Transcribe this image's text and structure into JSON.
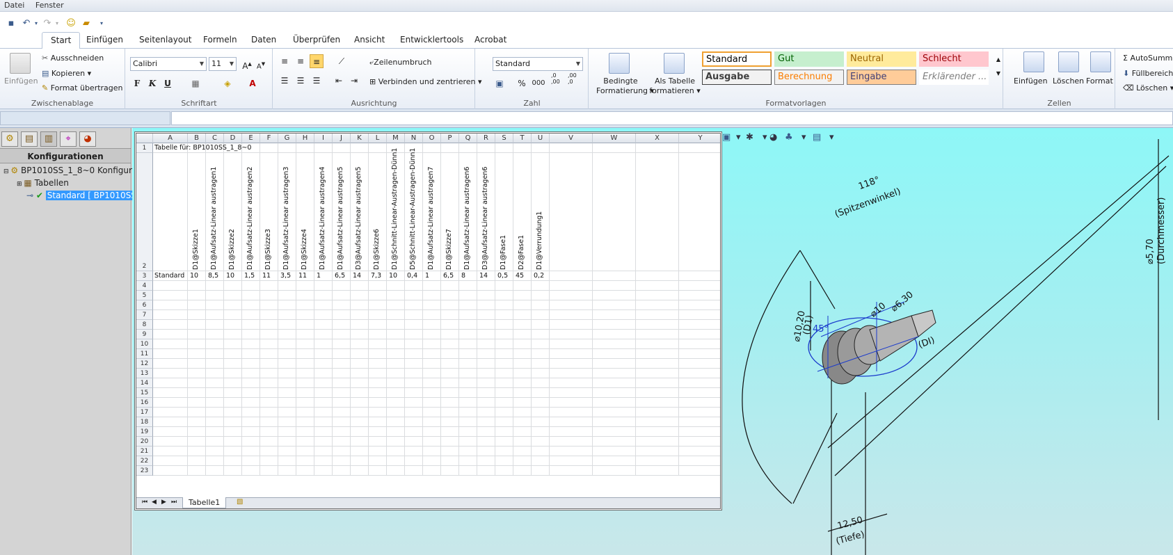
{
  "menubar": {
    "items": [
      "Datei",
      "Fenster"
    ]
  },
  "ribbon_tabs": [
    "Start",
    "Einfügen",
    "Seitenlayout",
    "Formeln",
    "Daten",
    "Überprüfen",
    "Ansicht",
    "Entwicklertools",
    "Acrobat"
  ],
  "clipboard": {
    "paste": "Einfügen",
    "cut": "Ausschneiden",
    "copy": "Kopieren",
    "format_painter": "Format übertragen",
    "group": "Zwischenablage"
  },
  "font": {
    "name": "Calibri",
    "size": "11",
    "bold": "F",
    "italic": "K",
    "underline": "U",
    "group": "Schriftart"
  },
  "alignment": {
    "wrap": "Zeilenumbruch",
    "merge": "Verbinden und zentrieren",
    "group": "Ausrichtung"
  },
  "number": {
    "format": "Standard",
    "percent": "%",
    "thousands": "000",
    "inc_decimals": ",0 ,00",
    "dec_decimals": ",00 ,0",
    "group": "Zahl"
  },
  "styles": {
    "cond_format": [
      "Bedingte",
      "Formatierung"
    ],
    "as_table": [
      "Als Tabelle",
      "formatieren"
    ],
    "cells": [
      {
        "label": "Standard",
        "bg": "#ffffff",
        "fg": "#000000",
        "border": "#f0a030"
      },
      {
        "label": "Gut",
        "bg": "#c6efce",
        "fg": "#006100",
        "border": "#c6efce"
      },
      {
        "label": "Neutral",
        "bg": "#ffeb9c",
        "fg": "#9c6500",
        "border": "#ffeb9c"
      },
      {
        "label": "Schlecht",
        "bg": "#ffc7ce",
        "fg": "#9c0006",
        "border": "#ffc7ce"
      },
      {
        "label": "Ausgabe",
        "bg": "#f2f2f2",
        "fg": "#3f3f3f",
        "border": "#3f3f3f"
      },
      {
        "label": "Berechnung",
        "bg": "#f2f2f2",
        "fg": "#fa7d00",
        "border": "#7f7f7f"
      },
      {
        "label": "Eingabe",
        "bg": "#ffcc99",
        "fg": "#3f3f76",
        "border": "#7f7f7f"
      },
      {
        "label": "Erklärender ...",
        "bg": "#ffffff",
        "fg": "#7f7f7f",
        "border": "#ffffff"
      }
    ],
    "group": "Formatvorlagen"
  },
  "cells_group": {
    "insert": "Einfügen",
    "delete": "Löschen",
    "format": "Format",
    "group": "Zellen"
  },
  "editing": {
    "autosum": "AutoSumm",
    "fill": "Füllbereich",
    "clear": "Löschen"
  },
  "feature_manager": {
    "header": "Konfigurationen",
    "root": "BP1010SS_1_8~0 Konfigurat",
    "tables": "Tabellen",
    "config": "Standard [ BP1010SS"
  },
  "sheet": {
    "columns": [
      "A",
      "B",
      "C",
      "D",
      "E",
      "F",
      "G",
      "H",
      "I",
      "J",
      "K",
      "L",
      "M",
      "N",
      "O",
      "P",
      "Q",
      "R",
      "S",
      "T",
      "U",
      "V",
      "W",
      "X",
      "Y"
    ],
    "title": "Tabelle für: BP1010SS_1_8~0",
    "headers": [
      "D1@Skizze1",
      "D1@Aufsatz-Linear austragen1",
      "D1@Skizze2",
      "D1@Aufsatz-Linear austragen2",
      "D1@Skizze3",
      "D1@Aufsatz-Linear austragen3",
      "D1@Skizze4",
      "D1@Aufsatz-Linear austragen4",
      "D1@Aufsatz-Linear austragen5",
      "D3@Aufsatz-Linear austragen5",
      "D1@Skizze6",
      "D1@Schnitt-Linear-Austragen-Dünn1",
      "D5@Schnitt-Linear-Austragen-Dünn1",
      "D1@Aufsatz-Linear austragen7",
      "D1@Skizze7",
      "D1@Aufsatz-Linear austragen6",
      "D3@Aufsatz-Linear austragen6",
      "D1@Fase1",
      "D2@Fase1",
      "D1@Verrundung1"
    ],
    "row3_label": "Standard",
    "row3_values": [
      "10",
      "8,5",
      "10",
      "1,5",
      "11",
      "3,5",
      "11",
      "1",
      "6,5",
      "14",
      "7,3",
      "10",
      "0,4",
      "1",
      "6,5",
      "8",
      "14",
      "0,5",
      "45",
      "0,2"
    ],
    "row_numbers": [
      "1",
      "2",
      "3",
      "4",
      "5",
      "6",
      "7",
      "8",
      "9",
      "10",
      "11",
      "12",
      "13",
      "14",
      "15",
      "16",
      "17",
      "18",
      "19",
      "20",
      "21",
      "22",
      "23"
    ],
    "sheet_tab": "Tabelle1"
  },
  "drawing": {
    "angle": "118°",
    "angle_note": "(Spitzenwinkel)",
    "diam": "⌀5,70",
    "diam_note": "(Durchmesser)",
    "d1020": "⌀10,20",
    "d1020_note": "(D1)",
    "d10": "⌀10",
    "d630": "⌀6,30",
    "di": "(DI)",
    "depth": "12,50",
    "depth_note": "(Tiefe)",
    "deg45": "45°"
  }
}
